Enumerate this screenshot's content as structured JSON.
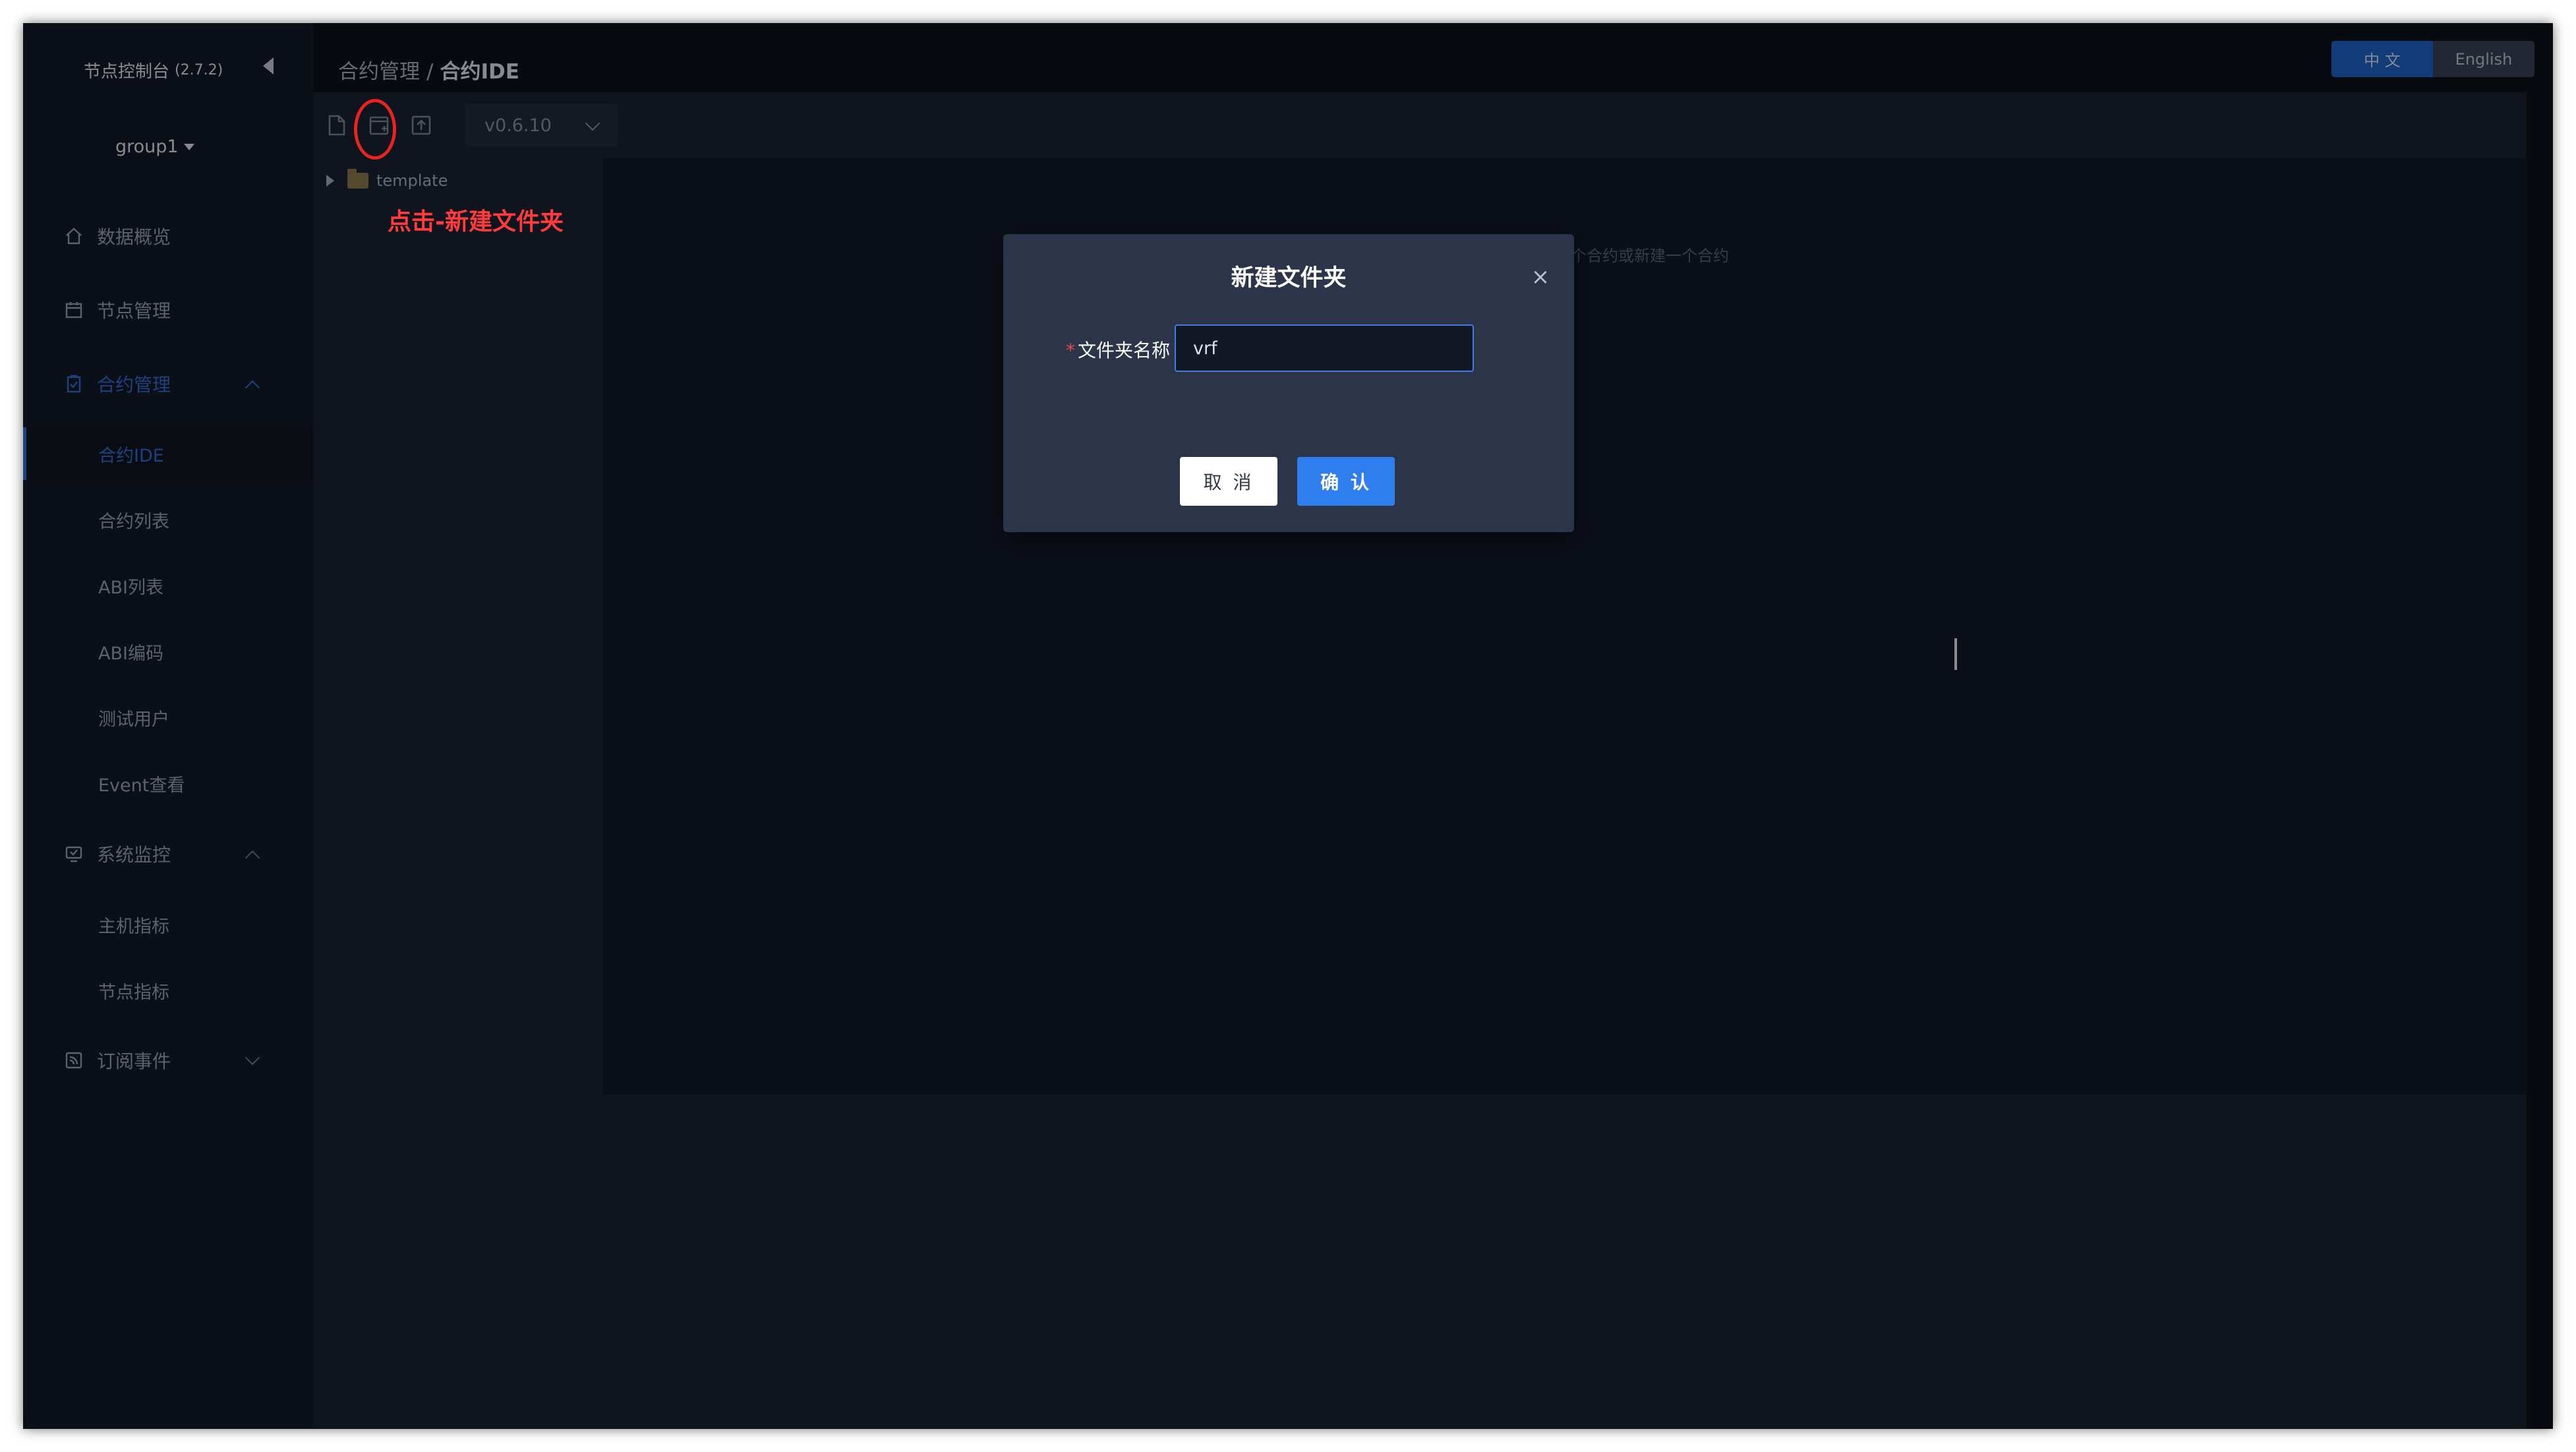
{
  "sidebar": {
    "title": "节点控制台",
    "version": "(2.7.2)",
    "group": "group1",
    "nav": {
      "overview": "数据概览",
      "nodes": "节点管理",
      "contract": "合约管理",
      "monitor": "系统监控",
      "subscribe": "订阅事件"
    },
    "contract_sub": [
      "合约IDE",
      "合约列表",
      "ABI列表",
      "ABI编码",
      "测试用户",
      "Event查看"
    ],
    "monitor_sub": [
      "主机指标",
      "节点指标"
    ]
  },
  "header": {
    "breadcrumb_parent": "合约管理",
    "breadcrumb_sep": "/",
    "breadcrumb_current": "合约IDE",
    "lang_zh": "中 文",
    "lang_en": "English"
  },
  "ide": {
    "compiler_version": "v0.6.10",
    "tree_folder": "template",
    "editor_hint": "个合约或新建一个合约"
  },
  "annotation": {
    "text": "点击-新建文件夹"
  },
  "modal": {
    "title": "新建文件夹",
    "required_mark": "*",
    "field_label": "文件夹名称",
    "field_value": "vrf",
    "cancel_label": "取 消",
    "confirm_label": "确 认"
  }
}
